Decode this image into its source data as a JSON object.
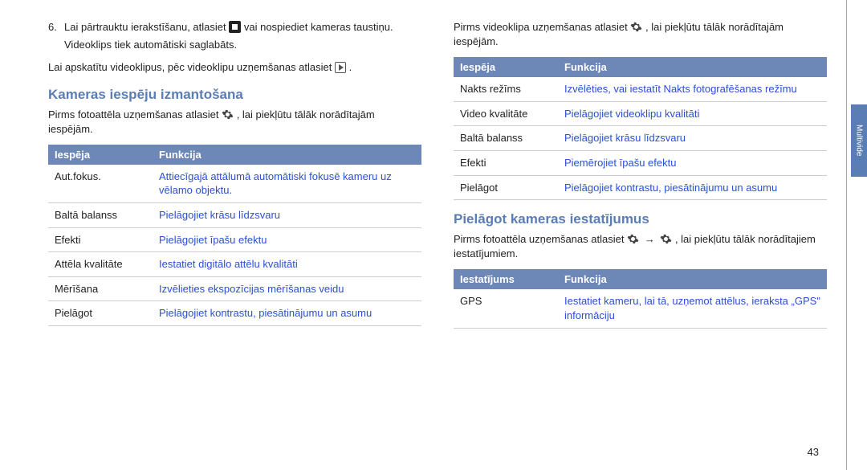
{
  "page_number": "43",
  "side_tab": "Multivide",
  "left": {
    "step_num": "6.",
    "step_text_before": "Lai pārtrauktu ierakstīšanu, atlasiet ",
    "step_text_after": " vai nospiediet kameras taustiņu.",
    "step_sub": "Videoklips tiek automātiski saglabāts.",
    "para2_before": "Lai apskatītu videoklipus, pēc videoklipu uzņemšanas atlasiet ",
    "para2_after": ".",
    "heading": "Kameras iespēju izmantošana",
    "intro_before": "Pirms fotoattēla uzņemšanas atlasiet ",
    "intro_after": ", lai piekļūtu tālāk norādītajām iespējām.",
    "th1": "Iespēja",
    "th2": "Funkcija",
    "rows": [
      {
        "o": "Aut.fokus.",
        "f": "Attiecīgajā attālumā automātiski fokusē kameru uz vēlamo objektu."
      },
      {
        "o": "Baltā balanss",
        "f": "Pielāgojiet krāsu līdzsvaru"
      },
      {
        "o": "Efekti",
        "f": "Pielāgojiet īpašu efektu"
      },
      {
        "o": "Attēla kvalitāte",
        "f": "Iestatiet digitālo attēlu kvalitāti"
      },
      {
        "o": "Mērīšana",
        "f": "Izvēlieties ekspozīcijas mērīšanas veidu"
      },
      {
        "o": "Pielāgot",
        "f": "Pielāgojiet kontrastu, piesātinājumu un asumu"
      }
    ]
  },
  "right": {
    "intro_before": "Pirms videoklipa uzņemšanas atlasiet ",
    "intro_after": ", lai piekļūtu tālāk norādītajām iespējām.",
    "th1": "Iespēja",
    "th2": "Funkcija",
    "rows1": [
      {
        "o": "Nakts režīms",
        "f": "Izvēlēties, vai iestatīt Nakts fotografēšanas režīmu"
      },
      {
        "o": "Video kvalitāte",
        "f": "Pielāgojiet videoklipu kvalitāti"
      },
      {
        "o": "Baltā balanss",
        "f": "Pielāgojiet krāsu līdzsvaru"
      },
      {
        "o": "Efekti",
        "f": "Piemērojiet īpašu efektu"
      },
      {
        "o": "Pielāgot",
        "f": "Pielāgojiet kontrastu, piesātinājumu un asumu"
      }
    ],
    "heading2": "Pielāgot kameras iestatījumus",
    "intro2_before": "Pirms fotoattēla uzņemšanas atlasiet ",
    "intro2_mid": " → ",
    "intro2_after": ", lai piekļūtu tālāk norādītajiem iestatījumiem.",
    "th3": "Iestatījums",
    "th4": "Funkcija",
    "rows2": [
      {
        "o": "GPS",
        "f": "Iestatiet kameru, lai tā, uzņemot attēlus, ieraksta „GPS\" informāciju"
      }
    ]
  }
}
